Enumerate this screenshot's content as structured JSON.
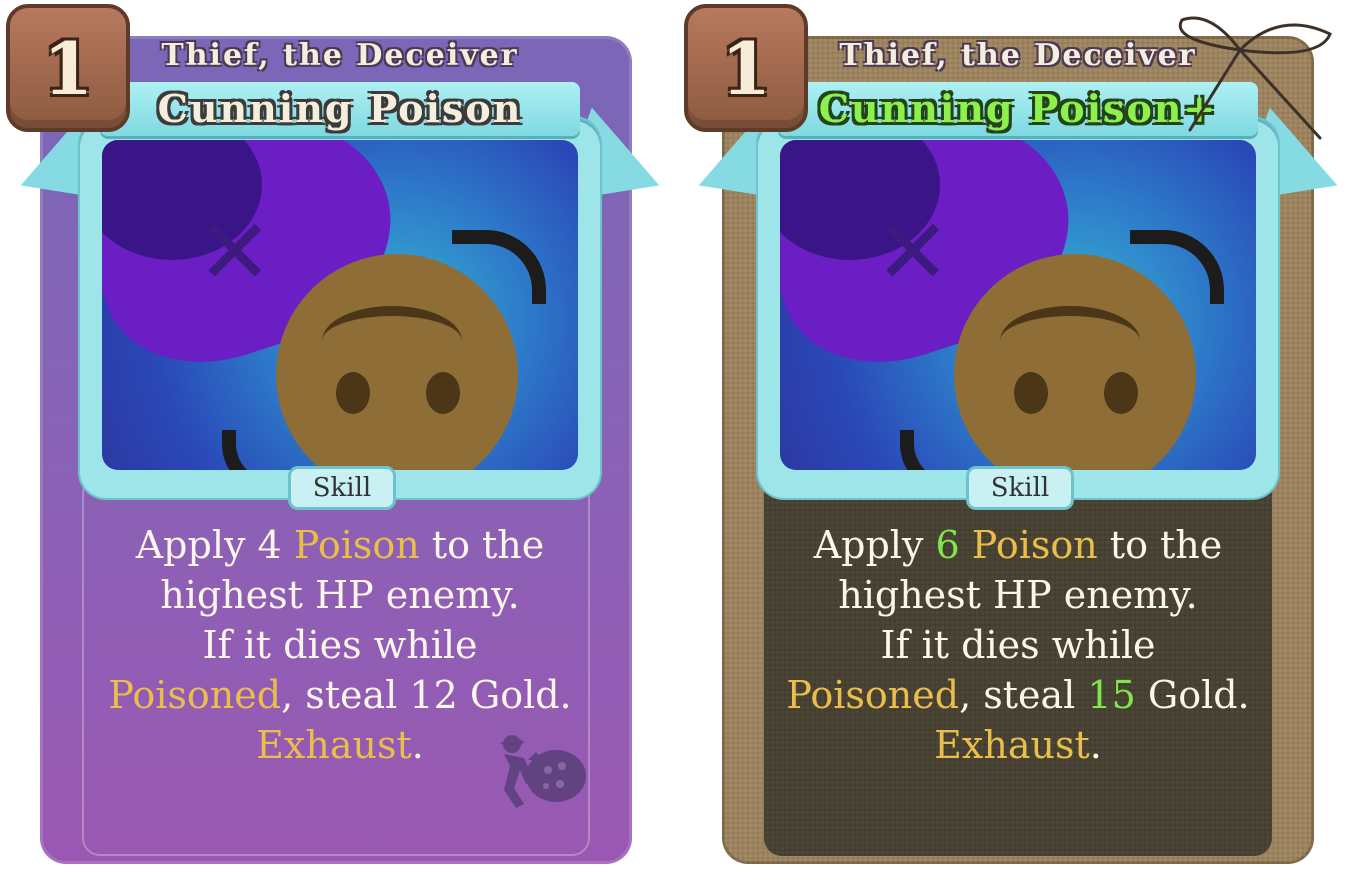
{
  "cards": [
    {
      "cost": "1",
      "subtitle": "Thief, the Deceiver",
      "title": "Cunning Poison",
      "type": "Skill",
      "description": {
        "line1_pre": "Apply 4 ",
        "line1_kw": "Poison",
        "line1_post": " to the",
        "line2": "highest HP enemy.",
        "line3": "If it dies while",
        "line4_kw": "Poisoned",
        "line4_post": ", steal 12 Gold.",
        "line5_kw": "Exhaust",
        "line5_post": "."
      }
    },
    {
      "cost": "1",
      "subtitle": "Thief, the Deceiver",
      "title": "Cunning Poison+",
      "type": "Skill",
      "description": {
        "line1_pre": "Apply ",
        "line1_up": "6",
        "line1_mid": " ",
        "line1_kw": "Poison",
        "line1_post": " to the",
        "line2": "highest HP enemy.",
        "line3": "If it dies while",
        "line4_kw": "Poisoned",
        "line4_mid": ", steal ",
        "line4_up": "15",
        "line4_post": " Gold.",
        "line5_kw": "Exhaust",
        "line5_post": "."
      }
    }
  ],
  "colors": {
    "keyword": "#e9be4a",
    "upgrade": "#7ee84a",
    "card_left_bg": "#8763b6",
    "card_right_bg": "#a48a64"
  },
  "icons": [
    "thief-emblem-icon",
    "twine-bow-icon",
    "face-icon"
  ]
}
